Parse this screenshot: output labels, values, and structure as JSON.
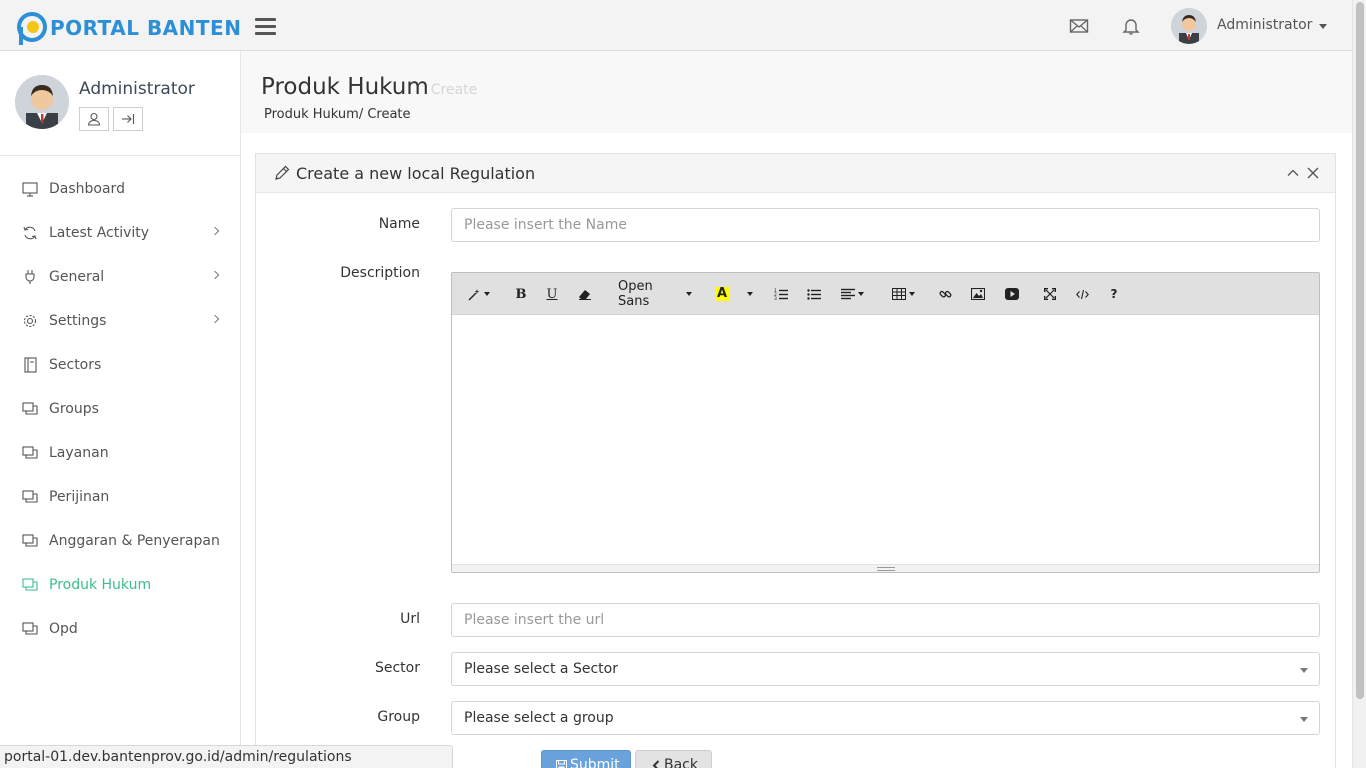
{
  "brand": {
    "name": "PORTAL BANTEN",
    "color": "#2d8fd5"
  },
  "topbar": {
    "user_name": "Administrator",
    "icons": [
      "envelope-icon",
      "bell-icon"
    ]
  },
  "sidebar": {
    "profile_name": "Administrator",
    "profile_buttons": [
      "user-icon",
      "sign-out-icon"
    ],
    "active_color": "#3bbf8a",
    "items": [
      {
        "label": "Dashboard",
        "icon": "monitor-icon",
        "has_children": false
      },
      {
        "label": "Latest Activity",
        "icon": "refresh-icon",
        "has_children": true
      },
      {
        "label": "General",
        "icon": "plug-icon",
        "has_children": true
      },
      {
        "label": "Settings",
        "icon": "gear-icon",
        "has_children": true
      },
      {
        "label": "Sectors",
        "icon": "book-icon",
        "has_children": false
      },
      {
        "label": "Groups",
        "icon": "window-icon",
        "has_children": false
      },
      {
        "label": "Layanan",
        "icon": "window-icon",
        "has_children": false
      },
      {
        "label": "Perijinan",
        "icon": "window-icon",
        "has_children": false
      },
      {
        "label": "Anggaran & Penyerapan",
        "icon": "window-icon",
        "has_children": false
      },
      {
        "label": "Produk Hukum",
        "icon": "window-icon",
        "has_children": false,
        "active": true
      },
      {
        "label": "Opd",
        "icon": "window-icon",
        "has_children": false
      }
    ]
  },
  "page": {
    "title": "Produk Hukum",
    "subtitle": "Create",
    "breadcrumb": "Produk Hukum/ Create"
  },
  "panel": {
    "title": "Create a new local Regulation",
    "tools": [
      "chevron-up-icon",
      "close-icon"
    ]
  },
  "form": {
    "name_label": "Name",
    "name_placeholder": "Please insert the Name",
    "name_value": "",
    "description_label": "Description",
    "url_label": "Url",
    "url_placeholder": "Please insert the url",
    "url_value": "",
    "sector_label": "Sector",
    "sector_value": "Please select a Sector",
    "group_label": "Group",
    "group_value": "Please select a group",
    "submit_label": "Submit",
    "back_label": "Back"
  },
  "editor": {
    "font_name": "Open Sans",
    "toolbar": [
      "magic-icon",
      "bold-icon",
      "underline-icon",
      "eraser-icon",
      "font-select",
      "text-color-icon",
      "ordered-list-icon",
      "unordered-list-icon",
      "align-icon",
      "table-icon",
      "link-icon",
      "picture-icon",
      "video-icon",
      "fullscreen-icon",
      "code-icon",
      "help-icon"
    ]
  },
  "status": {
    "url": "portal-01.dev.bantenprov.go.id/admin/regulations"
  }
}
